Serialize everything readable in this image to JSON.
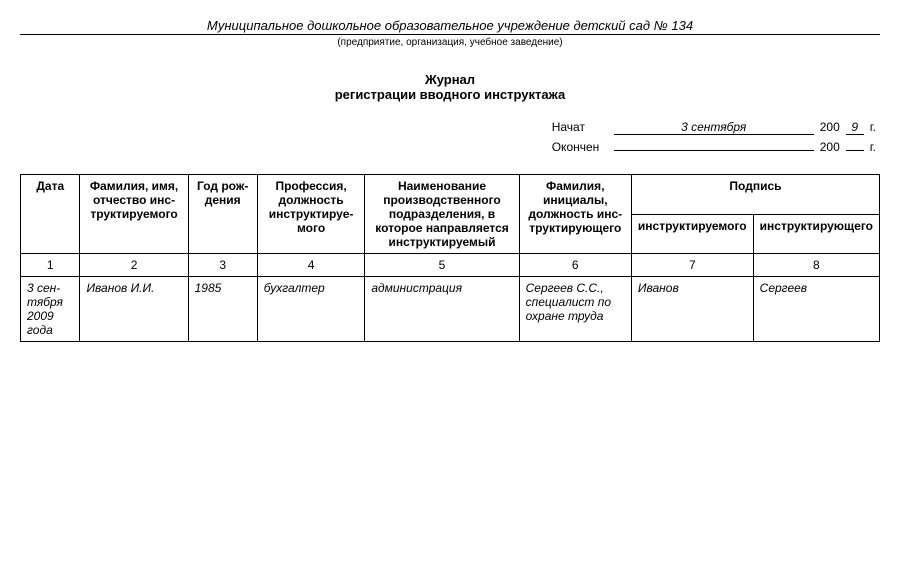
{
  "org": {
    "title": "Муниципальное дошкольное образовательное учреждение детский сад № 134",
    "sub": "(предприятие, организация, учебное заведение)"
  },
  "doc": {
    "line1": "Журнал",
    "line2": "регистрации вводного инструктажа"
  },
  "dates": {
    "start_label": "Начат",
    "start_value": "3 сентября",
    "start_century": "200",
    "start_year": "9",
    "end_label": "Окончен",
    "end_value": "",
    "end_century": "200",
    "end_year": "",
    "g_suffix": "г."
  },
  "headers": {
    "date": "Дата",
    "fio": "Фамилия, имя, отчество инс­труктируемого",
    "birth": "Год рож­дения",
    "prof": "Профессия, должность инструктируе­мого",
    "dept": "Наименование производственного подразделения, в которое направляется инструктируемый",
    "instructor": "Фамилия, инициалы, должность инс­труктирующего",
    "sign_group": "Подпись",
    "sign1": "инструктируемого",
    "sign2": "инструктирующего"
  },
  "colnums": {
    "c1": "1",
    "c2": "2",
    "c3": "3",
    "c4": "4",
    "c5": "5",
    "c6": "6",
    "c7": "7",
    "c8": "8"
  },
  "row": {
    "date": "3 сен­тября 2009 года",
    "fio": "Иванов И.И.",
    "birth": "1985",
    "prof": "бухгалтер",
    "dept": "администрация",
    "instructor": "Сергеев С.С., специалист по охране труда",
    "sign1": "Иванов",
    "sign2": "Сергеев"
  }
}
